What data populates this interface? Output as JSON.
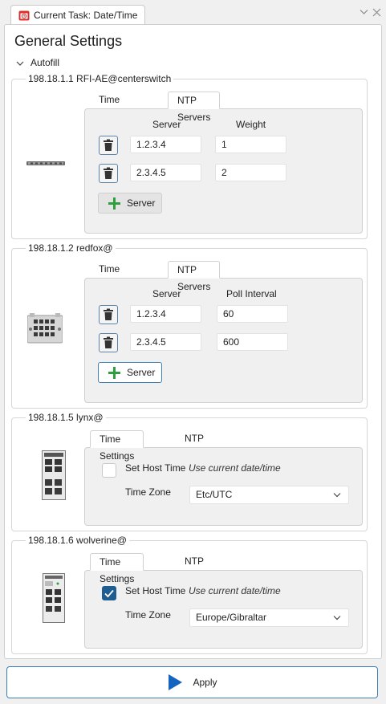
{
  "tab": {
    "title": "Current Task: Date/Time",
    "icon": "calendar-clock-icon"
  },
  "window_controls": [
    "chevron-down-icon",
    "close-icon"
  ],
  "page": {
    "title": "General Settings"
  },
  "autofill": {
    "label": "Autofill",
    "expanded": true
  },
  "subtabs": {
    "time": "Time Settings",
    "ntp": "NTP Servers"
  },
  "add_server_label": "Server",
  "set_host_time_label": "Set Host Time",
  "use_current_label": "Use current date/time",
  "time_zone_label": "Time Zone",
  "devices": [
    {
      "title": "198.18.1.1 RFI-AE@centerswitch",
      "active_tab": "ntp",
      "col1": "Server",
      "col2": "Weight",
      "rows": [
        {
          "server": "1.2.3.4",
          "value": "1"
        },
        {
          "server": "2.3.4.5",
          "value": "2"
        }
      ]
    },
    {
      "title": "198.18.1.2 redfox@",
      "active_tab": "ntp",
      "col1": "Server",
      "col2": "Poll Interval",
      "rows": [
        {
          "server": "1.2.3.4",
          "value": "60"
        },
        {
          "server": "2.3.4.5",
          "value": "600"
        }
      ]
    },
    {
      "title": "198.18.1.5 lynx@",
      "active_tab": "time",
      "set_host_time": false,
      "time_zone": "Etc/UTC"
    },
    {
      "title": "198.18.1.6 wolverine@",
      "active_tab": "time",
      "set_host_time": true,
      "time_zone": "Europe/Gibraltar"
    }
  ],
  "apply": {
    "label": "Apply"
  },
  "colors": {
    "accent": "#1e5d91",
    "add_icon": "#2e9e3e",
    "apply_icon": "#1565c0",
    "tab_icon": "#d9302c"
  }
}
